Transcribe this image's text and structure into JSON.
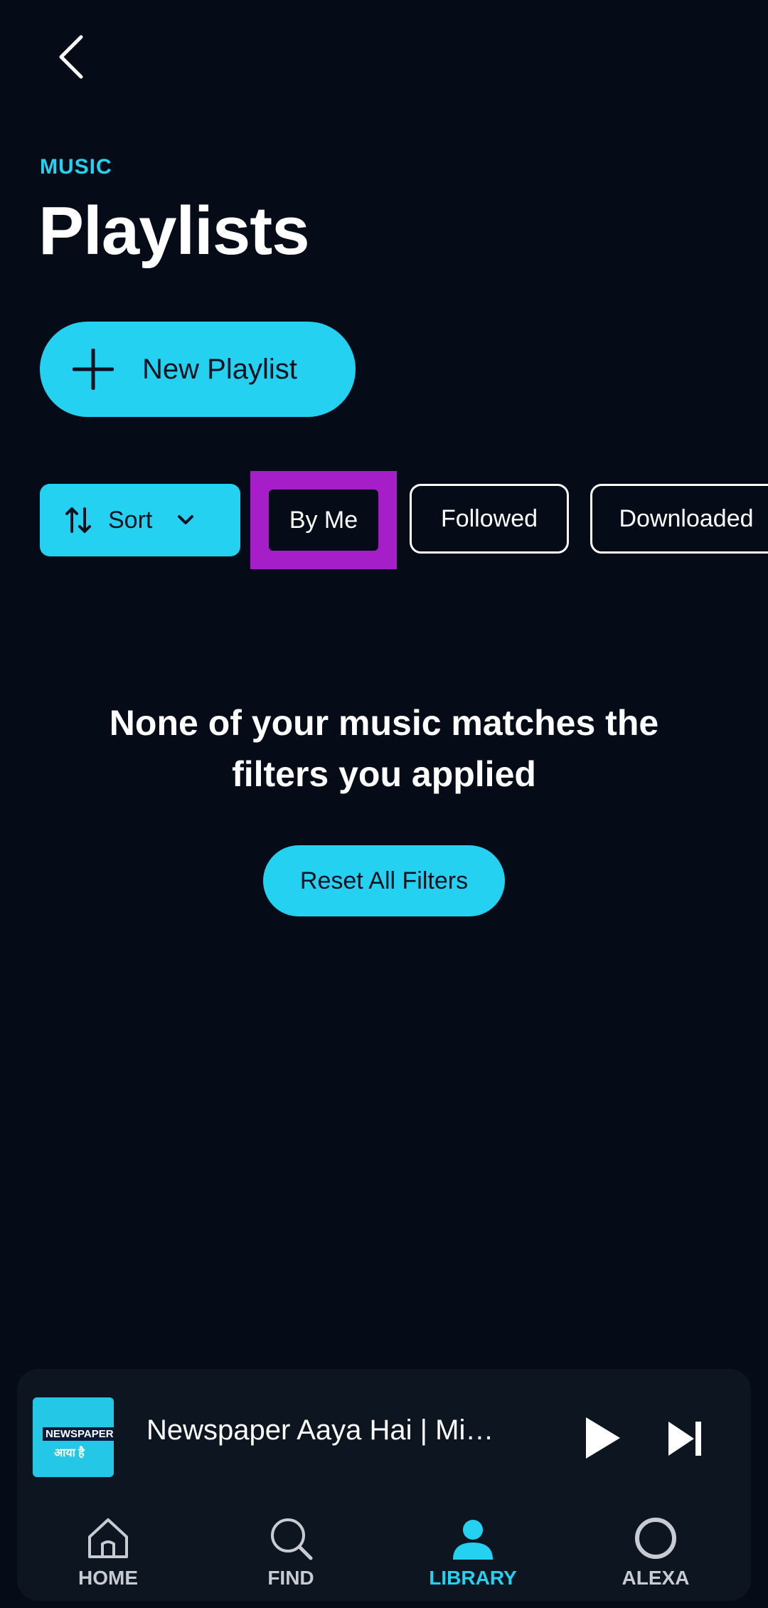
{
  "header": {
    "section_label": "MUSIC",
    "title": "Playlists"
  },
  "actions": {
    "new_playlist_label": "New Playlist"
  },
  "filters": {
    "sort_label": "Sort",
    "chips": [
      "By Me",
      "Followed",
      "Downloaded"
    ]
  },
  "empty_state": {
    "message": "None of your music matches the filters you applied",
    "reset_label": "Reset All Filters"
  },
  "now_playing": {
    "track_title": "Newspaper Aaya Hai | Mi…",
    "art_text_1": "NEWSPAPER",
    "art_text_2": "आया है"
  },
  "nav": {
    "items": [
      {
        "label": "HOME",
        "icon": "home-icon"
      },
      {
        "label": "FIND",
        "icon": "search-icon"
      },
      {
        "label": "LIBRARY",
        "icon": "library-icon"
      },
      {
        "label": "ALEXA",
        "icon": "alexa-icon"
      }
    ],
    "active": "LIBRARY"
  },
  "colors": {
    "background": "#050c17",
    "accent": "#25d1f0",
    "highlight": "#a61ec8"
  }
}
